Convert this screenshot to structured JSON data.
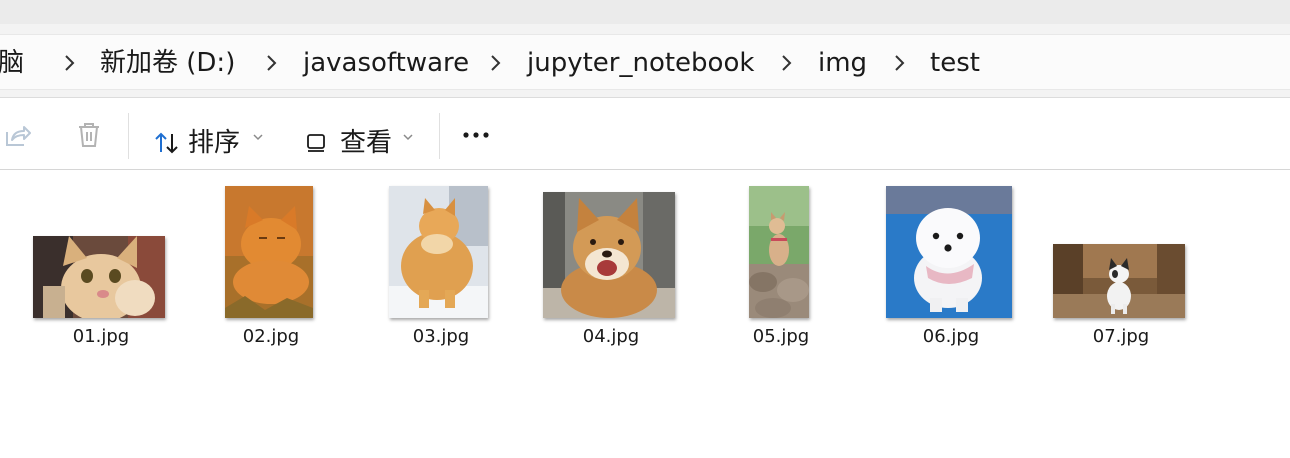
{
  "breadcrumb": {
    "items": [
      "电脑",
      "新加卷 (D:)",
      "javasoftware",
      "jupyter_notebook",
      "img",
      "test"
    ]
  },
  "toolbar": {
    "sort_label": "排序",
    "view_label": "查看"
  },
  "files": [
    {
      "name": "01.jpg",
      "subject": "kitten waving"
    },
    {
      "name": "02.jpg",
      "subject": "orange cat in hay"
    },
    {
      "name": "03.jpg",
      "subject": "orange cat in snow"
    },
    {
      "name": "04.jpg",
      "subject": "smiling shiba inu"
    },
    {
      "name": "05.jpg",
      "subject": "shiba inu on rocks"
    },
    {
      "name": "06.jpg",
      "subject": "white pomeranian"
    },
    {
      "name": "07.jpg",
      "subject": "french bulldog on path"
    }
  ],
  "colors": {
    "accent": "#1f6fd1",
    "chrome": "#f3f3f3"
  }
}
